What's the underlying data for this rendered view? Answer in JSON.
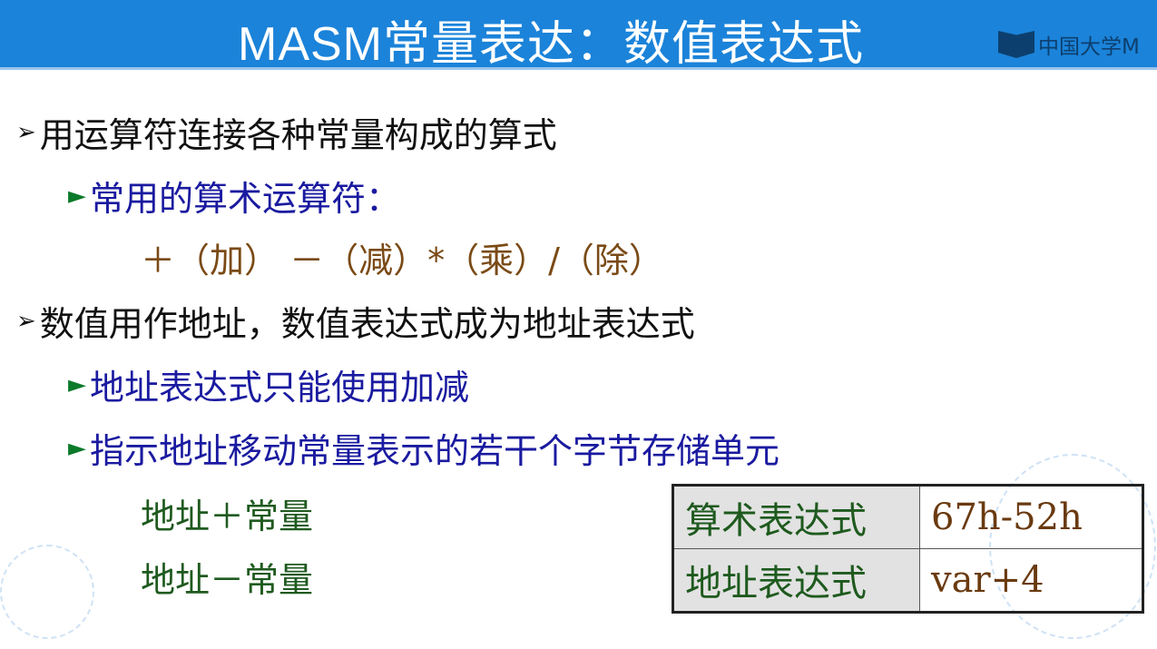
{
  "header": {
    "title": "MASM常量表达：数值表达式",
    "logo_text": "中国大学M"
  },
  "bullets": [
    {
      "marker": "➢",
      "text": "用运算符连接各种常量构成的算式"
    },
    {
      "marker": "►",
      "text": "常用的算术运算符："
    },
    {
      "text": "＋（加） －（减）*（乘）/（除）"
    },
    {
      "marker": "➢",
      "text": "数值用作地址，数值表达式成为地址表达式"
    },
    {
      "marker": "►",
      "text": "地址表达式只能使用加减"
    },
    {
      "marker": "►",
      "text": "指示地址移动常量表示的若干个字节存储单元"
    },
    {
      "text": "地址＋常量"
    },
    {
      "text": "地址－常量"
    }
  ],
  "table": [
    {
      "label": "算术表达式",
      "value": "67h-52h"
    },
    {
      "label": "地址表达式",
      "value": "var+4"
    }
  ]
}
